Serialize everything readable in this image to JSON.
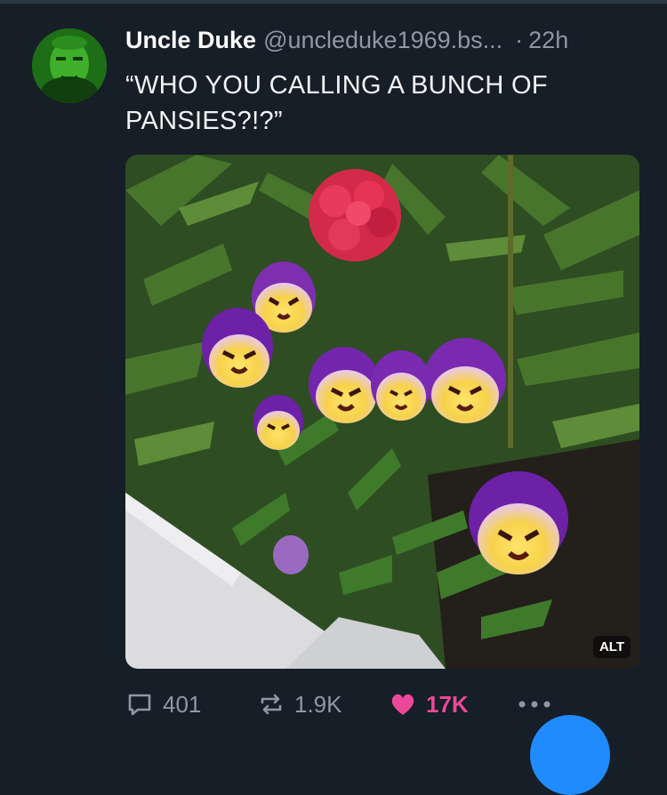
{
  "post": {
    "author_name": "Uncle Duke",
    "author_handle": "@uncleduke1969.bs...",
    "separator": "·",
    "time": "22h",
    "text": "“WHO YOU CALLING A BUNCH OF PANSIES?!?”",
    "image_alt_badge": "ALT"
  },
  "actions": {
    "replies": "401",
    "reposts": "1.9K",
    "likes": "17K"
  },
  "icons": {
    "reply": "speech-bubble-icon",
    "repost": "repost-arrows-icon",
    "like": "heart-icon",
    "more": "ellipsis-icon"
  },
  "colors": {
    "background": "#161e27",
    "muted_text": "#8c99a6",
    "like_pink": "#ec4899",
    "accent_blue": "#208bfe"
  }
}
